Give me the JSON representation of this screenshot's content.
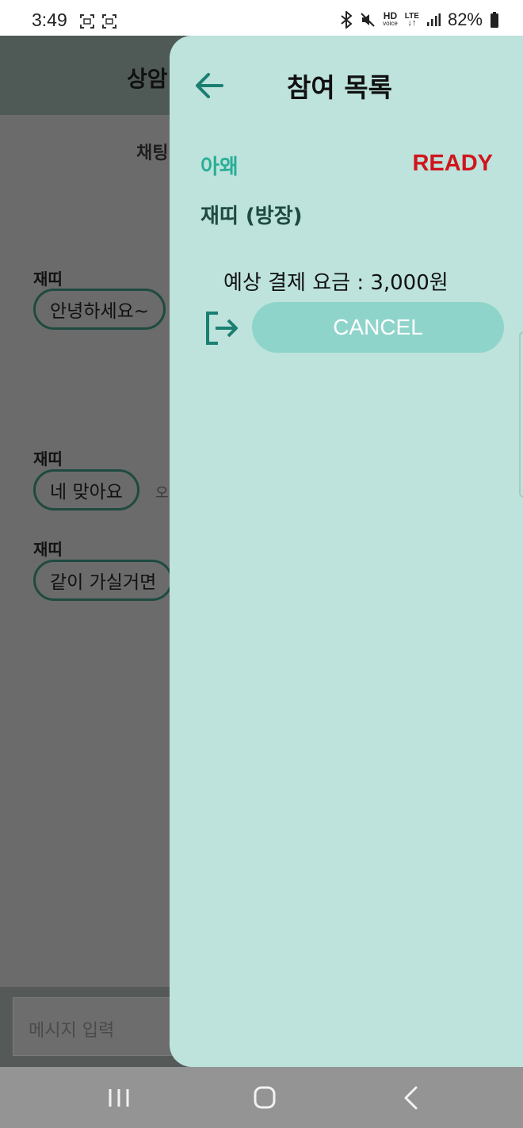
{
  "status_bar": {
    "time": "3:49",
    "hd_label": "HD",
    "voice_label": "voice",
    "lte_label": "LTE",
    "battery": "82%"
  },
  "chat": {
    "title": "상암",
    "subtitle": "채팅",
    "messages": [
      {
        "sender": "재띠",
        "text": "안녕하세요~",
        "time": ""
      },
      {
        "sender": "재띠",
        "text": "네 맞아요",
        "time": "오"
      },
      {
        "sender": "재띠",
        "text": "같이 가실거면",
        "time": ""
      }
    ],
    "input_placeholder": "메시지 입력"
  },
  "drawer": {
    "title": "참여 목록",
    "members": [
      {
        "name": "아왜",
        "status": "READY"
      },
      {
        "name": "재띠 (방장)",
        "status": ""
      }
    ],
    "fare_text": "예상 결제 요금 : 3,000원",
    "cancel_label": "CANCEL"
  },
  "colors": {
    "drawer_bg": "#bde3dc",
    "accent": "#2aae96",
    "ready": "#d0151c",
    "cancel_button": "#8fd4ca"
  },
  "icons": [
    "back-arrow-icon",
    "exit-icon",
    "bluetooth-icon",
    "mute-icon",
    "signal-icon",
    "battery-icon",
    "recent-apps-icon",
    "home-icon",
    "back-icon"
  ]
}
